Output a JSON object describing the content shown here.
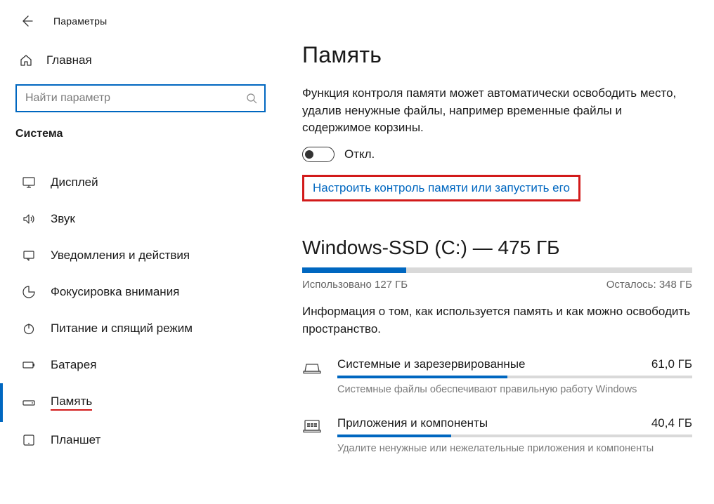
{
  "window": {
    "title": "Параметры"
  },
  "search": {
    "placeholder": "Найти параметр"
  },
  "sidebar": {
    "home": "Главная",
    "category": "Система",
    "items": [
      {
        "icon": "display",
        "label": "Дисплей",
        "selected": false
      },
      {
        "icon": "sound",
        "label": "Звук",
        "selected": false
      },
      {
        "icon": "notif",
        "label": "Уведомления и действия",
        "selected": false
      },
      {
        "icon": "focus",
        "label": "Фокусировка внимания",
        "selected": false
      },
      {
        "icon": "power",
        "label": "Питание и спящий режим",
        "selected": false
      },
      {
        "icon": "battery",
        "label": "Батарея",
        "selected": false
      },
      {
        "icon": "storage",
        "label": "Память",
        "selected": true,
        "underline": true
      },
      {
        "icon": "tablet",
        "label": "Планшет",
        "selected": false
      }
    ]
  },
  "main": {
    "title": "Память",
    "storage_sense_desc": "Функция контроля памяти может автоматически освободить место, удалив ненужные файлы, например временные файлы и содержимое корзины.",
    "toggle_state": "Откл.",
    "configure_link": "Настроить контроль памяти или запустить его",
    "drive": {
      "heading": "Windows-SSD (C:) — 475 ГБ",
      "used_label": "Использовано 127 ГБ",
      "remaining_label": "Осталось: 348 ГБ",
      "used_pct": 26.7
    },
    "info_text": "Информация о том, как используется память и как можно освободить пространство.",
    "categories": [
      {
        "icon": "system",
        "name": "Системные и зарезервированные",
        "size": "61,0 ГБ",
        "sub": "Системные файлы обеспечивают правильную работу Windows",
        "pct": 48
      },
      {
        "icon": "apps",
        "name": "Приложения и компоненты",
        "size": "40,4 ГБ",
        "sub": "Удалите ненужные или нежелательные приложения и компоненты",
        "pct": 32
      }
    ]
  }
}
